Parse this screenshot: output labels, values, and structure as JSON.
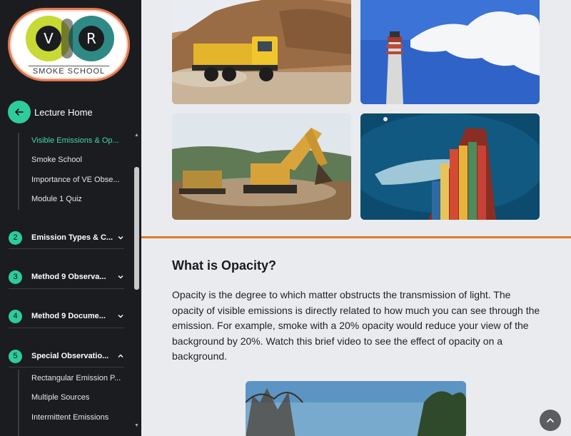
{
  "logo": {
    "left_letter": "V",
    "right_letter": "R",
    "text": "SMOKE SCHOOL"
  },
  "nav": {
    "home_label": "Lecture Home",
    "module1_items": [
      {
        "label": "Visible Emissions & Op...",
        "active": true
      },
      {
        "label": "Smoke School",
        "active": false
      },
      {
        "label": "Importance of VE Obse...",
        "active": false
      },
      {
        "label": "Module 1 Quiz",
        "active": false
      }
    ],
    "sections": [
      {
        "num": "2",
        "title": "Emission Types & C...",
        "expanded": false
      },
      {
        "num": "3",
        "title": "Method 9 Observa...",
        "expanded": false
      },
      {
        "num": "4",
        "title": "Method 9 Docume...",
        "expanded": false
      },
      {
        "num": "5",
        "title": "Special Observatio...",
        "expanded": true
      }
    ],
    "section5_items": [
      {
        "label": "Rectangular Emission P..."
      },
      {
        "label": "Multiple Sources"
      },
      {
        "label": "Intermittent Emissions"
      }
    ]
  },
  "main": {
    "images": [
      "dump-truck-photo",
      "smokestack-photo",
      "excavator-photo",
      "container-ship-photo"
    ],
    "heading": "What is Opacity?",
    "paragraph": "Opacity is the degree to which matter obstructs the transmission of light. The opacity of visible emissions is directly related to how much you can see through the emission. For example, smoke with a 20% opacity would reduce your view of the background by 20%. Watch this brief video to see the effect of opacity on a background."
  },
  "colors": {
    "accent": "#2ecc9a",
    "divider": "#e07a2c",
    "sidebar_bg": "#1b1c20"
  }
}
